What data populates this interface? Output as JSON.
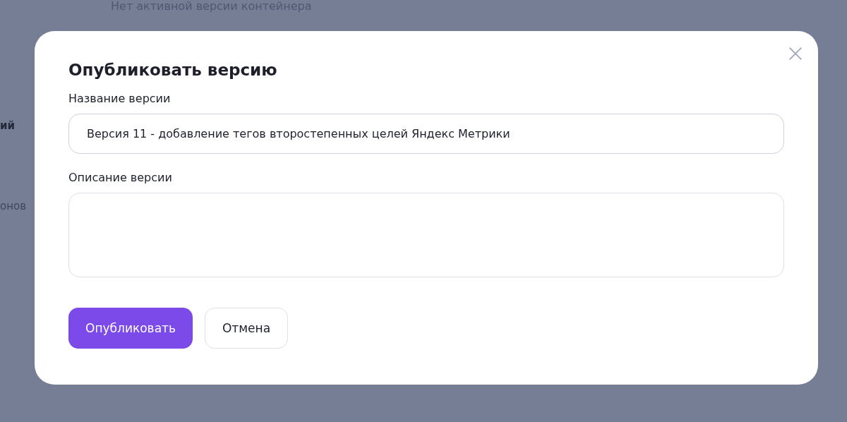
{
  "background": {
    "status_text": "Нет активной версии контейнера",
    "sidebar_items": [
      "ий",
      "онов"
    ]
  },
  "dialog": {
    "title": "Опубликовать версию",
    "fields": [
      {
        "kind": "input",
        "label": "Название версии",
        "value": "Версия 11 - добавление тегов второстепенных целей Яндекс Метрики"
      },
      {
        "kind": "textarea",
        "label": "Описание версии"
      }
    ],
    "buttons": [
      {
        "label": "Опубликовать",
        "kind": "primary"
      },
      {
        "label": "Отмена",
        "kind": "secondary"
      }
    ]
  }
}
